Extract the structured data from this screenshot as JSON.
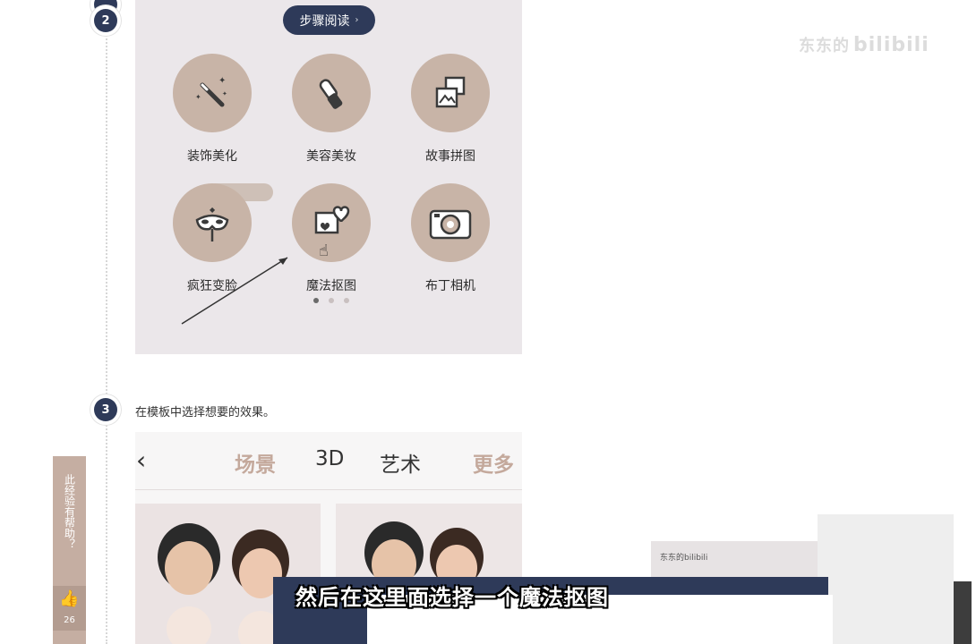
{
  "steps": [
    {
      "number": "2"
    },
    {
      "number": "3",
      "instruction": "在模板中选择想要的效果。"
    }
  ],
  "top_panel": {
    "read_button": "步骤阅读",
    "menu": [
      {
        "label": "装饰美化",
        "icon": "magic-wand-icon"
      },
      {
        "label": "美容美妆",
        "icon": "lipstick-icon"
      },
      {
        "label": "故事拼图",
        "icon": "photo-collage-icon"
      },
      {
        "label": "疯狂变脸",
        "icon": "mask-icon"
      },
      {
        "label": "魔法抠图",
        "icon": "heart-frame-icon"
      },
      {
        "label": "布丁相机",
        "icon": "camera-icon"
      }
    ],
    "page_dots": 3,
    "active_dot": 0
  },
  "template_panel": {
    "tabs": [
      {
        "label": "场景",
        "color": "#c4a99c"
      },
      {
        "label": "3D",
        "color": "#333333"
      },
      {
        "label": "艺术",
        "color": "#333333"
      },
      {
        "label": "更多",
        "color": "#c4a99c"
      }
    ]
  },
  "feedback": {
    "question": "此经验有帮助？",
    "like_count": "26"
  },
  "watermark": {
    "text": "东东的",
    "logo": "bilibili"
  },
  "caption": "然后在这里面选择一个魔法抠图",
  "inset_label": "东东的bilibili"
}
